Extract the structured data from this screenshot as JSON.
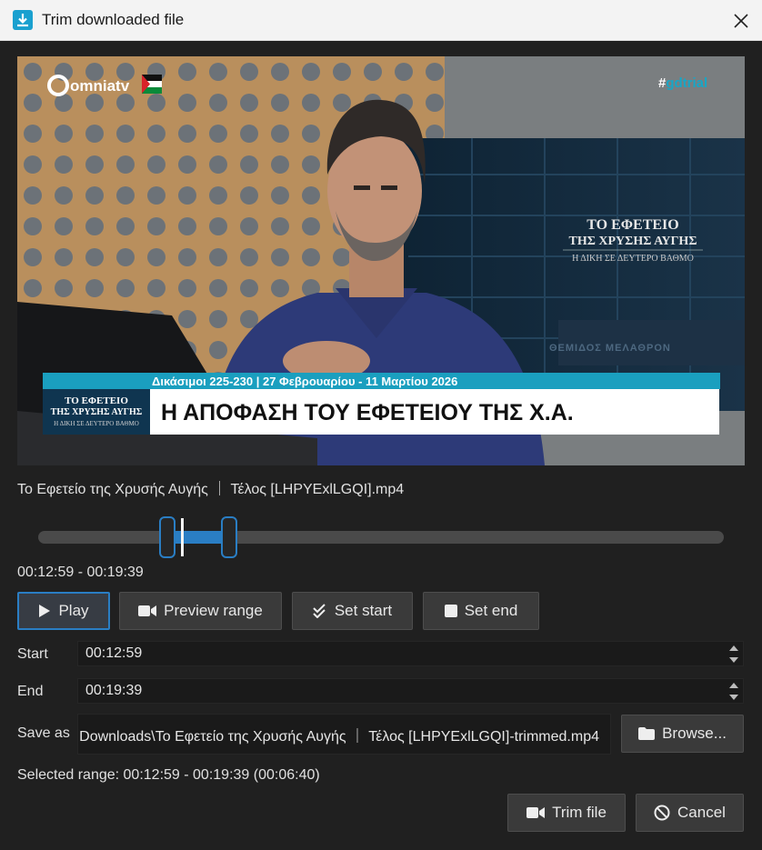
{
  "window": {
    "title": "Trim downloaded file"
  },
  "video": {
    "logo_text": "omniatv",
    "hashtag_prefix": "#",
    "hashtag": "gdtrial",
    "wall_title_line1": "ΤΟ ΕΦΕΤΕΙΟ",
    "wall_title_line2": "ΤΗΣ ΧΡΥΣΗΣ ΑΥΓΗΣ",
    "wall_title_line3": "Η ΔΙΚΗ ΣΕ ΔΕΥΤΕΡΟ ΒΑΘΜΟ",
    "wall_sign": "ΘΕΜΙΔΟΣ ΜΕΛΑΘΡΟΝ",
    "ticker_top": "Δικάσιμοι 225-230 | 27 Φεβρουαρίου - 11 Μαρτίου 2026",
    "box_line1": "ΤΟ ΕΦΕΤΕΙΟ",
    "box_line2": "ΤΗΣ ΧΡΥΣΗΣ ΑΥΓΗΣ",
    "box_line3": "Η ΔΙΚΗ ΣΕ ΔΕΥΤΕΡΟ ΒΑΘΜΟ",
    "headline": "Η ΑΠΟΦΑΣΗ ΤΟΥ ΕΦΕΤΕΙΟΥ ΤΗΣ Χ.Α."
  },
  "file_name": "Το Εφετείο της Χρυσής Αυγής ｜ Τέλος [LHPYExlLGQI].mp4",
  "slider": {
    "start_fraction": 0.188,
    "end_fraction": 0.278,
    "position_fraction": 0.21
  },
  "range_display": "00:12:59 - 00:19:39",
  "buttons": {
    "play": "Play",
    "preview": "Preview range",
    "set_start": "Set start",
    "set_end": "Set end",
    "browse": "Browse...",
    "trim": "Trim file",
    "cancel": "Cancel"
  },
  "fields": {
    "start_label": "Start",
    "start_value": "00:12:59",
    "end_label": "End",
    "end_value": "00:19:39",
    "save_label": "Save as",
    "save_value": "Downloads\\Το Εφετείο της Χρυσής Αυγής ｜ Τέλος [LHPYExlLGQI]-trimmed.mp4"
  },
  "summary": "Selected range: 00:12:59 - 00:19:39 (00:06:40)",
  "icons": {
    "app": "download-icon",
    "close": "close-icon",
    "play": "play-icon",
    "preview": "video-camera-icon",
    "set_start": "double-check-icon",
    "set_end": "stop-icon",
    "browse": "folder-icon",
    "trim": "video-camera-icon",
    "cancel": "ban-icon"
  },
  "colors": {
    "accent": "#2a7ec4",
    "channel_teal": "#1a9fbf",
    "background": "#202020"
  }
}
